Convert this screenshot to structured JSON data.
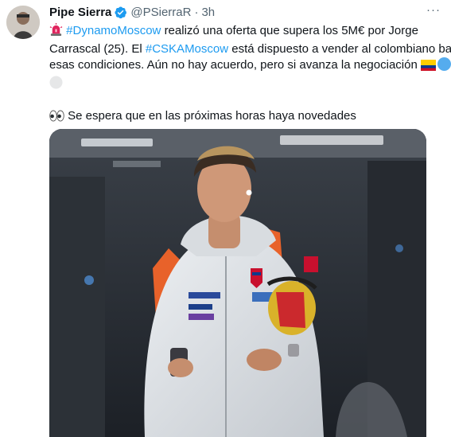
{
  "tweet": {
    "display_name": "Pipe Sierra",
    "handle": "@PSierraR",
    "separator": "·",
    "time": "3h",
    "more_glyph": "···",
    "line1_text": "realizó una oferta que supera los 5M€ por Jorge",
    "hashtag_dynamo": "#DynamoMoscow",
    "line2_text_a": "Carrascal (25). El ",
    "hashtag_cska": "#CSKAMoscow",
    "line2_text_b": " está dispuesto a vender al colombiano bajo",
    "line3_text": "esas condiciones. Aún no hay acuerdo, pero si avanza la negociación ",
    "line4_text": " Se espera que en las próximas horas haya novedades"
  },
  "icons": {
    "verified": "verified-badge-icon",
    "siren": "police-light-icon",
    "flag": "colombia-flag-icon",
    "blue_circle": "blue-circle-icon",
    "white_circle": "white-circle-icon",
    "eyes": "eyes-icon"
  },
  "colors": {
    "link": "#1d9bf0",
    "secondary_text": "#536471",
    "primary_text": "#0f1419"
  }
}
